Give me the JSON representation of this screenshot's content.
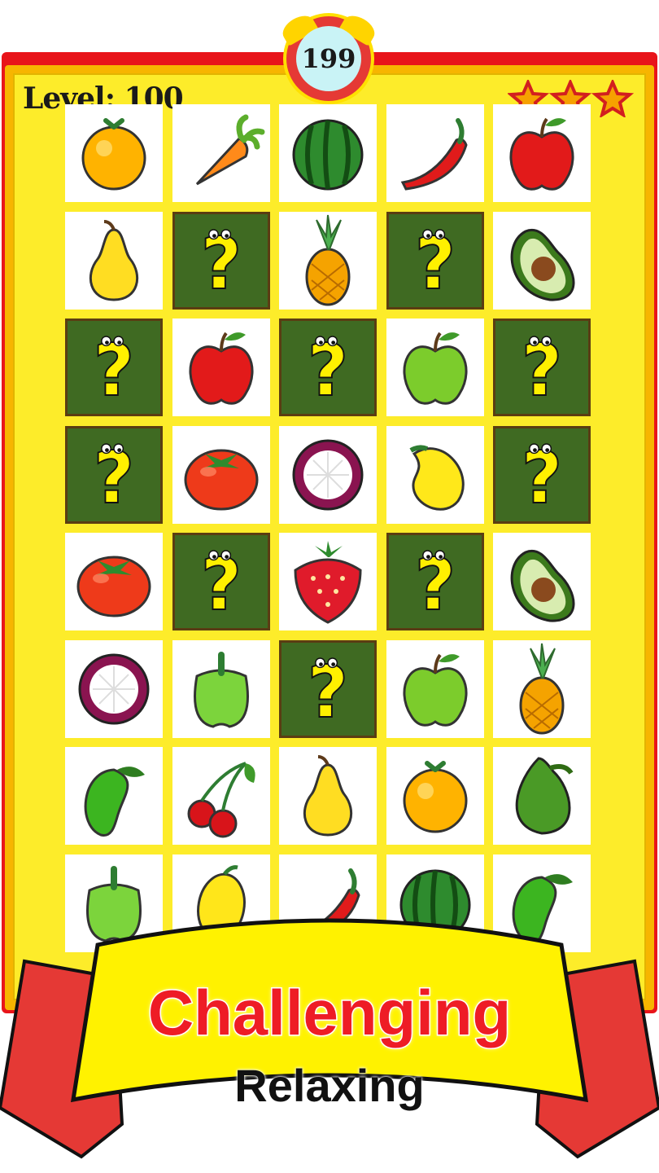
{
  "level": {
    "label": "Level: 100"
  },
  "timer": {
    "value": "199"
  },
  "stars": {
    "earned": 3,
    "total": 3,
    "icon": "star-icon"
  },
  "grid": {
    "rows": 8,
    "cols": 5,
    "tiles": [
      [
        "orange",
        "carrot",
        "watermelon",
        "chili",
        "red-apple"
      ],
      [
        "pear",
        "hidden",
        "pineapple",
        "hidden",
        "avocado"
      ],
      [
        "hidden",
        "red-apple",
        "hidden",
        "green-apple",
        "hidden"
      ],
      [
        "hidden",
        "tomato",
        "mangosteen",
        "mango",
        "hidden"
      ],
      [
        "tomato",
        "hidden",
        "strawberry",
        "hidden",
        "avocado"
      ],
      [
        "mangosteen",
        "green-pepper",
        "hidden",
        "green-apple",
        "pineapple"
      ],
      [
        "green-mango",
        "cherries",
        "pear",
        "orange",
        "green-avocado"
      ],
      [
        "green-pepper",
        "lemon",
        "chili",
        "watermelon",
        "green-mango"
      ]
    ]
  },
  "banner": {
    "headline": "Challenging",
    "subline": "Relaxing"
  },
  "colors": {
    "frame_red": "#e8141a",
    "board_yellow": "#fdec2a",
    "hidden_tile_green": "#3f6a22",
    "headline_red": "#ee1c25",
    "banner_yellow": "#fff200"
  }
}
